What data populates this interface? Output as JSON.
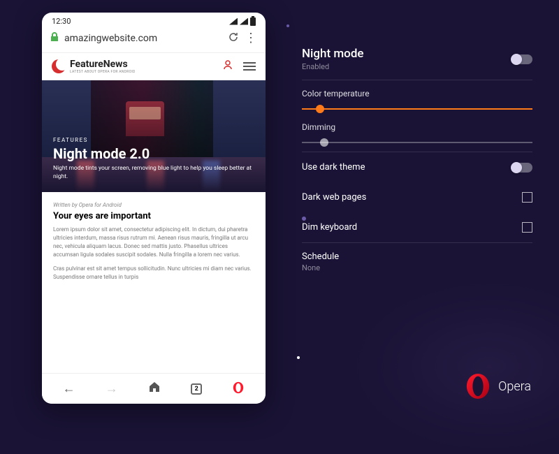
{
  "phone": {
    "status": {
      "time": "12:30"
    },
    "url": "amazingwebsite.com",
    "site": {
      "brand": "FeatureNews",
      "tagline": "LATEST ABOUT OPERA FOR ANDROID"
    },
    "hero": {
      "label": "FEATURES",
      "title": "Night mode 2.0",
      "subtitle": "Night mode tints your screen, removing blue light to help you sleep better at night."
    },
    "article": {
      "byline": "Written by Opera for Android",
      "title": "Your eyes are important",
      "p1": "Lorem ipsum dolor sit amet, consectetur adipiscing elit. In dictum, dui pharetra ultricies interdum, massa risus rutrum mi. Aenean risus mauris, fringilla ut arcu nec, vehicula aliquam lacus. Donec sed mattis justo. Phasellus ultrices accumsan ligula sodales suscipit sodales. Nulla fringilla a lorem nec varius.",
      "p2": "Cras pulvinar est sit amet tempus sollicitudin. Nunc ultricies mi diam nec varius. Suspendisse ornare tellus in turpis"
    },
    "tabs_count": "2"
  },
  "settings": {
    "title": "Night mode",
    "status": "Enabled",
    "color_temp": "Color temperature",
    "dimming": "Dimming",
    "dark_theme": "Use dark theme",
    "dark_pages": "Dark web pages",
    "dim_keyboard": "Dim keyboard",
    "schedule_label": "Schedule",
    "schedule_value": "None"
  },
  "brand": "Opera"
}
